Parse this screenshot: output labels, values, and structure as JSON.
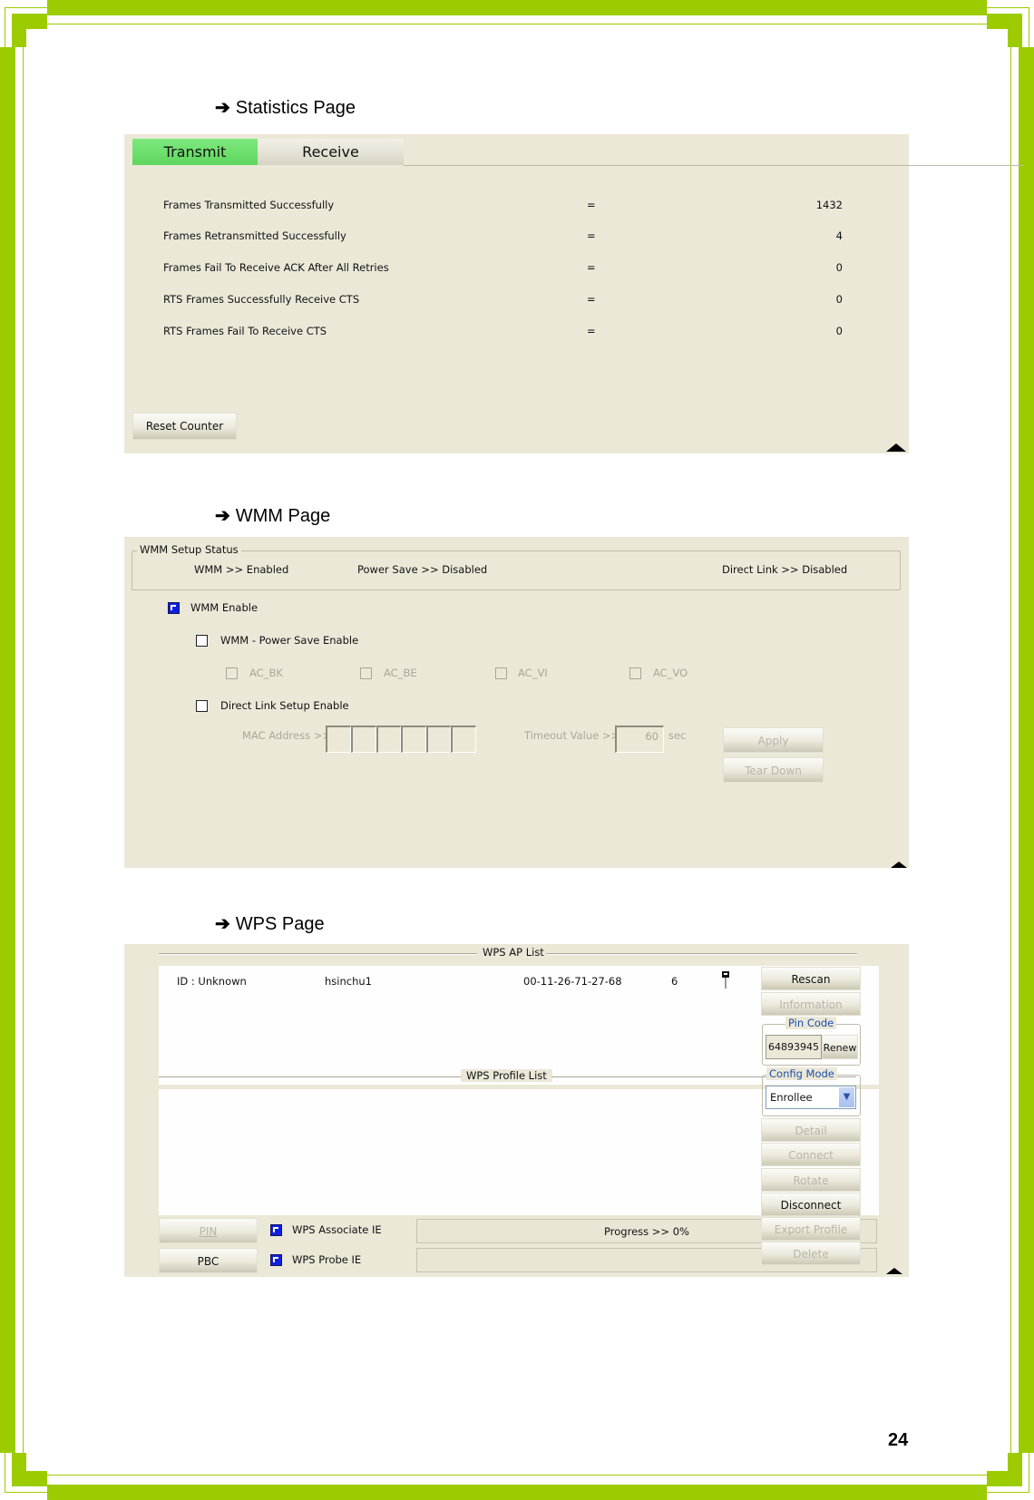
{
  "page_number": "24",
  "sections": {
    "statistics": {
      "heading_arrow": "➔",
      "heading": "Statistics Page",
      "tabs": [
        {
          "label": "Transmit",
          "active": true
        },
        {
          "label": "Receive",
          "active": false
        }
      ],
      "rows": [
        {
          "label": "Frames Transmitted Successfully",
          "sep": "=",
          "value": "1432"
        },
        {
          "label": "Frames Retransmitted Successfully",
          "sep": "=",
          "value": "4"
        },
        {
          "label": "Frames Fail To Receive ACK After All Retries",
          "sep": "=",
          "value": "0"
        },
        {
          "label": "RTS Frames Successfully Receive CTS",
          "sep": "=",
          "value": "0"
        },
        {
          "label": "RTS Frames Fail To Receive CTS",
          "sep": "=",
          "value": "0"
        }
      ],
      "reset_button": "Reset Counter",
      "collapse_icon": "triangle-up-icon"
    },
    "wmm": {
      "heading_arrow": "➔",
      "heading": "WMM Page",
      "status_group_label": "WMM Setup Status",
      "status": {
        "wmm": "WMM >> Enabled",
        "power_save": "Power Save >> Disabled",
        "direct_link": "Direct Link >> Disabled"
      },
      "wmm_enable": {
        "label": "WMM Enable",
        "checked": true
      },
      "power_save_enable": {
        "label": "WMM - Power Save Enable",
        "checked": false
      },
      "ac_options": [
        {
          "label": "AC_BK",
          "checked": false,
          "disabled": true
        },
        {
          "label": "AC_BE",
          "checked": false,
          "disabled": true
        },
        {
          "label": "AC_VI",
          "checked": false,
          "disabled": true
        },
        {
          "label": "AC_VO",
          "checked": false,
          "disabled": true
        }
      ],
      "direct_link_enable": {
        "label": "Direct Link Setup Enable",
        "checked": false
      },
      "mac_label": "MAC Address >>",
      "mac_fields": [
        "",
        "",
        "",
        "",
        "",
        ""
      ],
      "timeout_label": "Timeout Value >>",
      "timeout_value": "60",
      "timeout_unit": "sec",
      "apply_button": "Apply",
      "teardown_button": "Tear Down"
    },
    "wps": {
      "heading_arrow": "➔",
      "heading": "WPS Page",
      "ap_list_label": "WPS AP List",
      "ap_list": [
        {
          "id": "ID : Unknown",
          "ssid": "hsinchu1",
          "bssid": "00-11-26-71-27-68",
          "channel": "6",
          "icon": "key-icon"
        }
      ],
      "profile_list_label": "WPS Profile List",
      "profile_list": [],
      "pin_button": "PIN",
      "pbc_button": "PBC",
      "associate_ie": {
        "label": "WPS Associate IE",
        "checked": true
      },
      "probe_ie": {
        "label": "WPS Probe IE",
        "checked": true
      },
      "progress_text": "Progress >> 0%",
      "progress_percent": 0,
      "side_buttons": {
        "rescan": "Rescan",
        "information": "Information",
        "detail": "Detail",
        "connect": "Connect",
        "rotate": "Rotate",
        "disconnect": "Disconnect",
        "export_profile": "Export Profile",
        "delete": "Delete"
      },
      "pin_code_label": "Pin Code",
      "pin_code_value": "64893945",
      "renew_button": "Renew",
      "config_mode_label": "Config Mode",
      "config_mode_value": "Enrollee"
    }
  },
  "colors": {
    "border_green": "#9ccc00",
    "panel_bg": "#ebe8d8",
    "tab_active": "#6ee06e",
    "groupbox_title": "#1f4fa8"
  }
}
